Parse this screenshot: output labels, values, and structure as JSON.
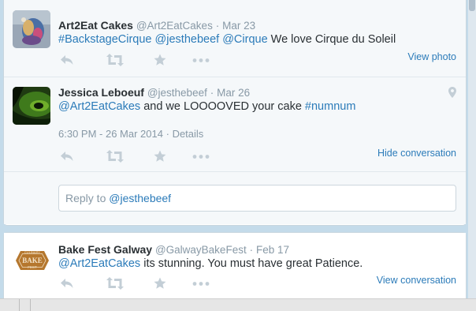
{
  "tweets": [
    {
      "fullname": "Art2Eat Cakes",
      "handle": "@Art2EatCakes",
      "separator": "·",
      "date": "Mar 23",
      "text_parts": [
        "#BackstageCirque",
        " ",
        "@jesthebeef",
        " ",
        "@Cirque",
        " We love Cirque du Soleil"
      ],
      "side_link": "View photo"
    },
    {
      "fullname": "Jessica Leboeuf",
      "handle": "@jesthebeef",
      "separator": "·",
      "date": "Mar 26",
      "text_parts": [
        "@Art2EatCakes",
        " and we LOOOOVED your cake ",
        "#numnum"
      ],
      "timestamp": "6:30 PM - 26 Mar 2014",
      "meta_separator": "·",
      "details_label": "Details",
      "side_link": "Hide conversation"
    },
    {
      "fullname": "Bake Fest Galway",
      "handle": "@GalwayBakeFest",
      "separator": "·",
      "date": "Feb 17",
      "text_parts": [
        "@Art2EatCakes",
        " its stunning. You must have great  Patience."
      ],
      "side_link": "View conversation"
    }
  ],
  "reply": {
    "prefix": "Reply to ",
    "mention": "@jesthebeef"
  },
  "logo": {
    "top": "CULINARY",
    "main": "BAKE",
    "bottom": "FEST"
  },
  "icons": [
    "reply-icon",
    "retweet-icon",
    "favorite-icon",
    "more-icon",
    "location-pin-icon"
  ],
  "colors": {
    "link": "#2b7bb9",
    "muted": "#8899a6",
    "text": "#292f33",
    "background": "#c4dbea"
  }
}
